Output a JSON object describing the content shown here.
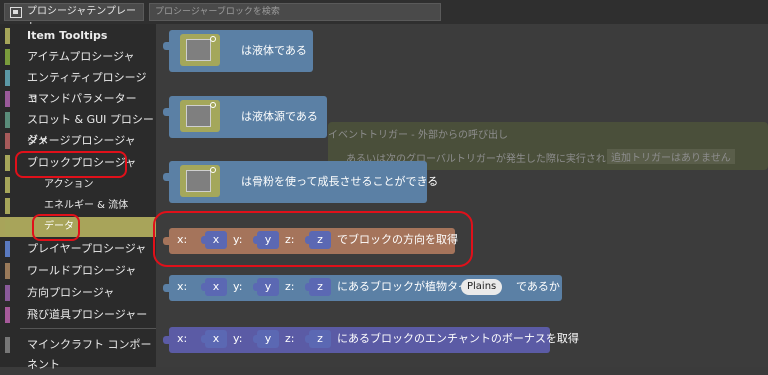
{
  "toolbar": {
    "template_label": "プロシージャテンプレート",
    "search_placeholder": "プロシージャーブロックを検索"
  },
  "sidebar": {
    "categories": [
      {
        "label": "Item Tooltips",
        "color": "#a6a65a"
      },
      {
        "label": "アイテムプロシージャ",
        "color": "#7a9c3c"
      },
      {
        "label": "エンティティプロシージャ",
        "color": "#5b98a6"
      },
      {
        "label": "コマンドパラメーター",
        "color": "#9a5a9a"
      },
      {
        "label": "スロット & GUI プロシージャ",
        "color": "#5a8c7a"
      },
      {
        "label": "ダメージプロシージャ",
        "color": "#a65a5a"
      },
      {
        "label": "ブロックプロシージャ",
        "color": "#a6a65a"
      },
      {
        "label": "アクション",
        "color": "#a6a65a"
      },
      {
        "label": "エネルギー & 流体",
        "color": "#a6a65a"
      },
      {
        "label": "データ",
        "color": "#a6a65a"
      },
      {
        "label": "プレイヤープロシージャ",
        "color": "#5a7ac0"
      },
      {
        "label": "ワールドプロシージャ",
        "color": "#9a7a5a"
      },
      {
        "label": "方向プロシージャ",
        "color": "#8a5a9a"
      },
      {
        "label": "飛び道具プロシージャー",
        "color": "#a65a9a"
      },
      {
        "label": "マインクラフト コンポーネント",
        "color": "#777777"
      }
    ]
  },
  "workspace": {
    "ghost_lines": [
      "イベントトリガー - 外部からの呼び出し",
      "あるいは次のグローバルトリガーが発生した際に実行される:"
    ],
    "ghost_dropdown": "追加トリガーはありません",
    "blocks": [
      {
        "label": "は液体である",
        "color": "#5b80a5"
      },
      {
        "label": "は液体源である",
        "color": "#5b80a5"
      },
      {
        "label": "は骨粉を使って成長させることができる",
        "color": "#5b80a5"
      }
    ],
    "coord_blocks": [
      {
        "x_label": "x:",
        "y_label": "y:",
        "z_label": "z:",
        "x_var": "x",
        "y_var": "y",
        "z_var": "z",
        "text": "でブロックの方向を取得",
        "color": "#a5745b"
      },
      {
        "x_label": "x:",
        "y_label": "y:",
        "z_label": "z:",
        "x_var": "x",
        "y_var": "y",
        "z_var": "z",
        "text": "にあるブロックが植物タイプ",
        "dropdown": "Plains",
        "text2": "であるか",
        "color": "#5b80a5"
      },
      {
        "x_label": "x:",
        "y_label": "y:",
        "z_label": "z:",
        "x_var": "x",
        "y_var": "y",
        "z_var": "z",
        "text": "にあるブロックのエンチャントのボーナスを取得",
        "color": "#5b5ba5"
      }
    ]
  }
}
